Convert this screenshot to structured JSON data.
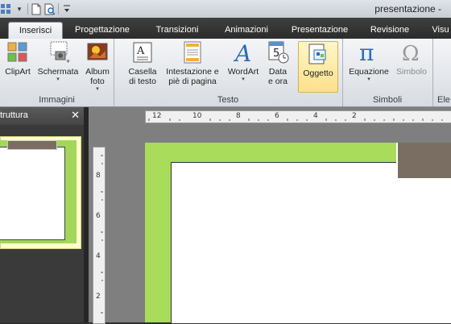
{
  "window": {
    "title": "presentazione -"
  },
  "quick_access": {
    "icons": [
      "grid-icon",
      "new-document-icon",
      "print-preview-icon",
      "customize-dropdown-icon"
    ]
  },
  "tabs": [
    {
      "label": "Inserisci",
      "active": true
    },
    {
      "label": "Progettazione"
    },
    {
      "label": "Transizioni"
    },
    {
      "label": "Animazioni"
    },
    {
      "label": "Presentazione"
    },
    {
      "label": "Revisione"
    },
    {
      "label": "Visu"
    }
  ],
  "ribbon": {
    "groups": {
      "immagini": {
        "label": "Immagini",
        "buttons": {
          "clipart": {
            "label": "ClipArt"
          },
          "schermata": {
            "label": "Schermata",
            "dropdown": "▾"
          },
          "album": {
            "label_line1": "Album",
            "label_line2": "foto",
            "dropdown": "▾"
          }
        }
      },
      "testo": {
        "label": "Testo",
        "buttons": {
          "casella": {
            "label_line1": "Casella",
            "label_line2": "di testo"
          },
          "intestazione": {
            "label_line1": "Intestazione e",
            "label_line2": "piè di pagina"
          },
          "wordart": {
            "label": "WordArt",
            "dropdown": "▾",
            "glyph": "A"
          },
          "data": {
            "label_line1": "Data",
            "label_line2": "e ora",
            "glyph": "5"
          },
          "oggetto": {
            "label": "Oggetto"
          }
        }
      },
      "simboli": {
        "label": "Simboli",
        "buttons": {
          "equazione": {
            "label": "Equazione",
            "dropdown": "▾",
            "glyph": "π"
          },
          "simbolo": {
            "label": "Simbolo",
            "glyph": "Ω"
          }
        }
      },
      "next": {
        "label": "Ele"
      }
    }
  },
  "pane": {
    "title": "truttura",
    "close": "✕"
  },
  "rulers": {
    "horizontal_labels": [
      "12",
      "10",
      "8",
      "6",
      "4",
      "2"
    ],
    "vertical_labels": [
      "8",
      "6",
      "4",
      "2"
    ]
  },
  "colors": {
    "slide_green": "#a8dc5a",
    "slide_brown": "#7a6e63",
    "highlight": "#ffe08a",
    "accent_blue": "#2b6cb5"
  }
}
